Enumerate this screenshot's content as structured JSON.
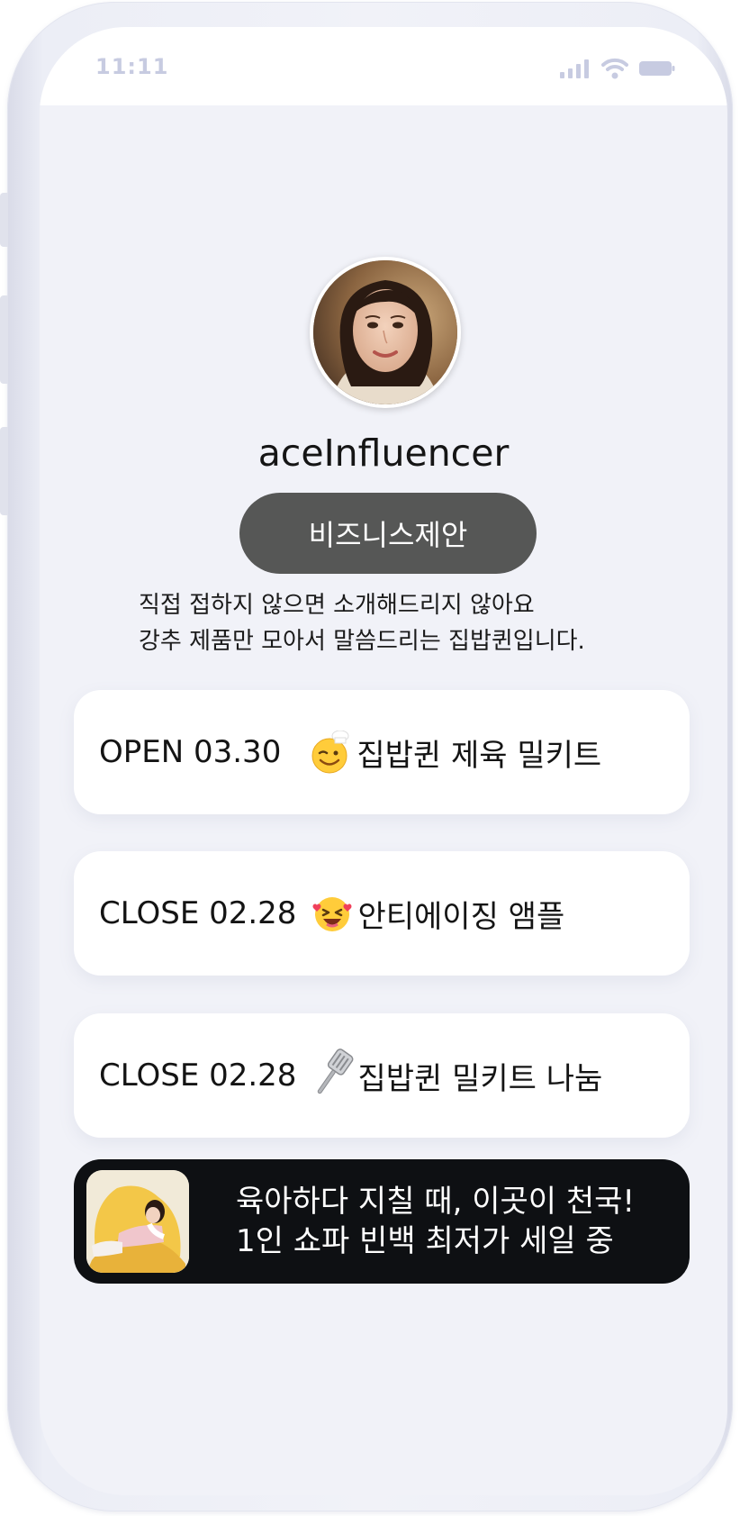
{
  "status_bar": {
    "time": "11:11",
    "icons": [
      "signal-icon",
      "wifi-icon",
      "battery-icon"
    ]
  },
  "profile": {
    "username": "aceInfluencer",
    "business_button_label": "비즈니스제안",
    "bio_lines": [
      "직접 접하지 않으면 소개해드리지 않아요",
      "강추 제품만 모아서 말씀드리는 집밥퀸입니다."
    ]
  },
  "links": [
    {
      "date": "OPEN 03.30",
      "icon": "chef-face-emoji",
      "title": "집밥퀸 제육 밀키트"
    },
    {
      "date": "CLOSE 02.28",
      "icon": "laughing-hearts-emoji",
      "title": "안티에이징 앰플"
    },
    {
      "date": "CLOSE 02.28",
      "icon": "spatula-icon",
      "title": "집밥퀸 밀키트 나눔"
    }
  ],
  "ad": {
    "line1": "육아하다 지칠 때, 이곳이 천국!",
    "line2": "1인 쇼파 빈백 최저가 세일 중"
  },
  "colors": {
    "background": "#f1f2f8",
    "button": "#565756",
    "card": "#ffffff",
    "ad_background": "#0e1013",
    "status_icons": "#c7cbe1"
  }
}
